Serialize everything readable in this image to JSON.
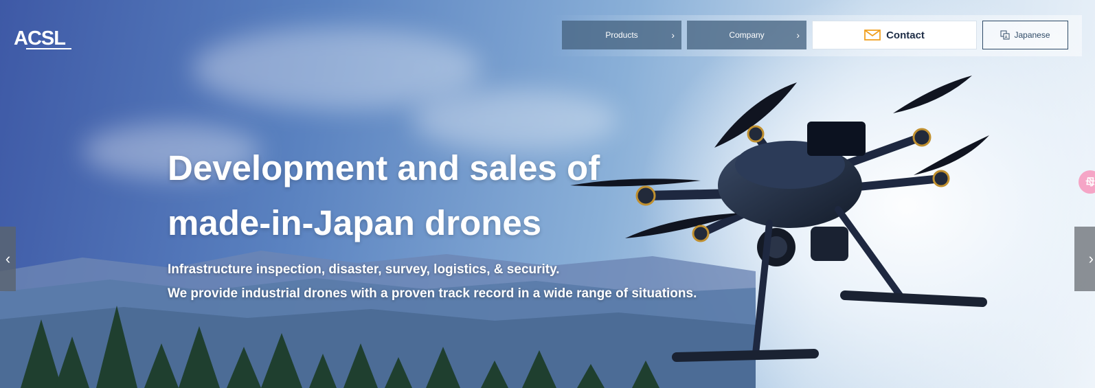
{
  "brand": {
    "logo_text": "ACSL"
  },
  "nav": {
    "products_label": "Products",
    "company_label": "Company",
    "contact_label": "Contact",
    "language_label": "Japanese",
    "chevron": "›"
  },
  "hero": {
    "headline_line1": "Development and sales of",
    "headline_line2": "made-in-Japan drones",
    "sub_line1": "Infrastructure inspection, disaster, survey, logistics, & security.",
    "sub_line2": "We provide industrial drones with a proven track record in a wide range of situations."
  },
  "carousel": {
    "prev": "‹",
    "next": "›"
  },
  "side_badge": {
    "label": "母"
  },
  "icons": {
    "contact": "mail-icon",
    "language": "language-icon",
    "nav_chevron": "chevron-right-icon"
  },
  "colors": {
    "accent_mail": "#f0a020",
    "nav_bg": "#46647f",
    "contact_text": "#1d2c45",
    "badge": "#f5a5c6"
  }
}
